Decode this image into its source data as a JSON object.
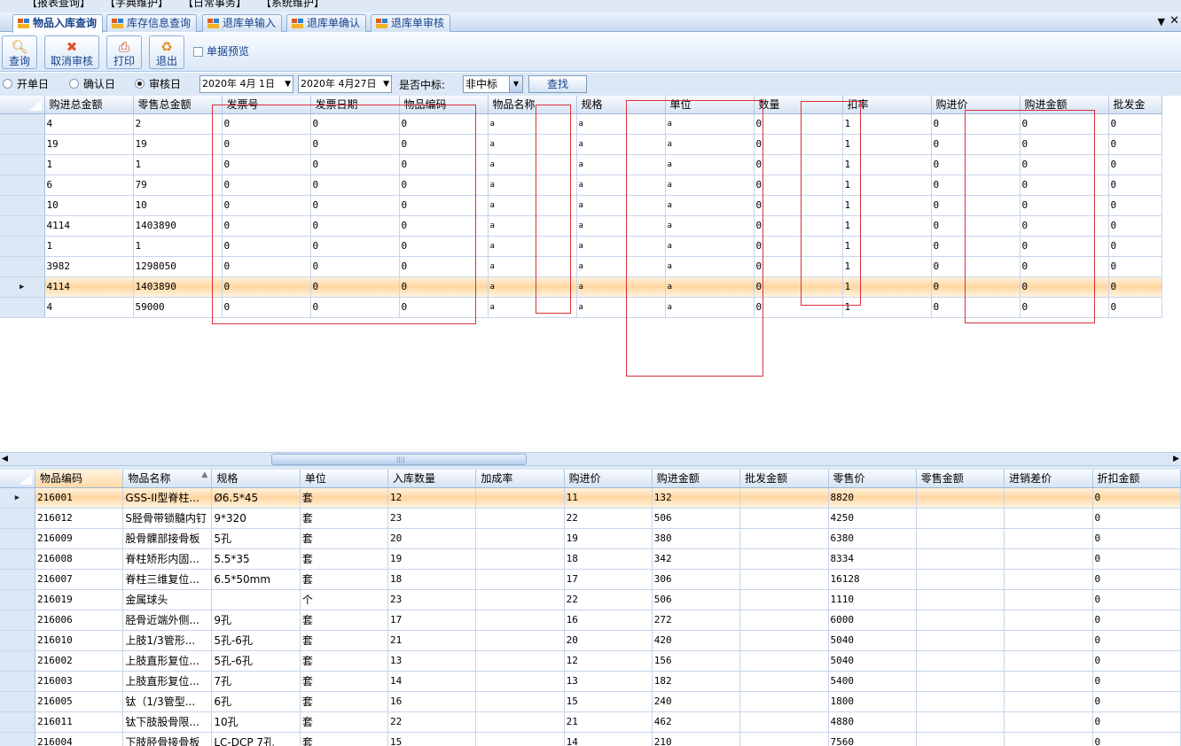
{
  "menu": [
    "】",
    "【报表查询】",
    "【字典维护】",
    "【日常事务】",
    "【系统维护】"
  ],
  "tabs": [
    "物品入库查询",
    "库存信息查询",
    "退库单输入",
    "退库单确认",
    "退库单审核"
  ],
  "tab_controls": {
    "menu": "▼",
    "close": "✕"
  },
  "toolbar": {
    "query": "查询",
    "cancel_audit": "取消审核",
    "print": "打印",
    "exit": "退出",
    "preview": "单据预览"
  },
  "filters": {
    "radio_open": "开单日",
    "radio_confirm": "确认日",
    "radio_audit": "审核日",
    "date_from": "2020年 4月 1日",
    "date_to": "2020年 4月27日",
    "bid_label": "是否中标:",
    "bid_value": "非中标",
    "find": "查找"
  },
  "grid1": {
    "columns": [
      "购进总金额",
      "零售总金额",
      "发票号",
      "发票日期",
      "物品编码",
      "物品名称",
      "规格",
      "单位",
      "数量",
      "扣率",
      "购进价",
      "购进金额",
      "批发金"
    ],
    "rows": [
      [
        "4",
        "2",
        "0",
        "0",
        "0",
        "a",
        "a",
        "a",
        "0",
        "1",
        "0",
        "0",
        "0"
      ],
      [
        "19",
        "19",
        "0",
        "0",
        "0",
        "a",
        "a",
        "a",
        "0",
        "1",
        "0",
        "0",
        "0"
      ],
      [
        "1",
        "1",
        "0",
        "0",
        "0",
        "a",
        "a",
        "a",
        "0",
        "1",
        "0",
        "0",
        "0"
      ],
      [
        "6",
        "79",
        "0",
        "0",
        "0",
        "a",
        "a",
        "a",
        "0",
        "1",
        "0",
        "0",
        "0"
      ],
      [
        "10",
        "10",
        "0",
        "0",
        "0",
        "a",
        "a",
        "a",
        "0",
        "1",
        "0",
        "0",
        "0"
      ],
      [
        "4114",
        "1403890",
        "0",
        "0",
        "0",
        "a",
        "a",
        "a",
        "0",
        "1",
        "0",
        "0",
        "0"
      ],
      [
        "1",
        "1",
        "0",
        "0",
        "0",
        "a",
        "a",
        "a",
        "0",
        "1",
        "0",
        "0",
        "0"
      ],
      [
        "3982",
        "1298050",
        "0",
        "0",
        "0",
        "a",
        "a",
        "a",
        "0",
        "1",
        "0",
        "0",
        "0"
      ],
      [
        "4114",
        "1403890",
        "0",
        "0",
        "0",
        "a",
        "a",
        "a",
        "0",
        "1",
        "0",
        "0",
        "0"
      ],
      [
        "4",
        "59000",
        "0",
        "0",
        "0",
        "a",
        "a",
        "a",
        "0",
        "1",
        "0",
        "0",
        "0"
      ]
    ],
    "selected_row": 8
  },
  "grid2": {
    "columns": [
      "物品编码",
      "物品名称",
      "规格",
      "单位",
      "入库数量",
      "加成率",
      "购进价",
      "购进金额",
      "批发金额",
      "零售价",
      "零售金额",
      "进销差价",
      "折扣金额"
    ],
    "sort_arrow": "▲",
    "rows": [
      [
        "216001",
        "GSS-II型脊柱...",
        "Ø6.5*45",
        "套",
        "12",
        "",
        "11",
        "132",
        "",
        "8820",
        "",
        "",
        "0"
      ],
      [
        "216012",
        "S胫骨带锁髓内钉",
        "9*320",
        "套",
        "23",
        "",
        "22",
        "506",
        "",
        "4250",
        "",
        "",
        "0"
      ],
      [
        "216009",
        "股骨髁部接骨板",
        "5孔",
        "套",
        "20",
        "",
        "19",
        "380",
        "",
        "6380",
        "",
        "",
        "0"
      ],
      [
        "216008",
        "脊柱矫形内固...",
        "5.5*35",
        "套",
        "19",
        "",
        "18",
        "342",
        "",
        "8334",
        "",
        "",
        "0"
      ],
      [
        "216007",
        "脊柱三维复位...",
        "6.5*50mm",
        "套",
        "18",
        "",
        "17",
        "306",
        "",
        "16128",
        "",
        "",
        "0"
      ],
      [
        "216019",
        "金属球头",
        "",
        "个",
        "23",
        "",
        "22",
        "506",
        "",
        "1110",
        "",
        "",
        "0"
      ],
      [
        "216006",
        "胫骨近端外侧...",
        "9孔",
        "套",
        "17",
        "",
        "16",
        "272",
        "",
        "6000",
        "",
        "",
        "0"
      ],
      [
        "216010",
        "上肢1/3管形...",
        "5孔-6孔",
        "套",
        "21",
        "",
        "20",
        "420",
        "",
        "5040",
        "",
        "",
        "0"
      ],
      [
        "216002",
        "上肢直形复位...",
        "5孔-6孔",
        "套",
        "13",
        "",
        "12",
        "156",
        "",
        "5040",
        "",
        "",
        "0"
      ],
      [
        "216003",
        "上肢直形复位...",
        "7孔",
        "套",
        "14",
        "",
        "13",
        "182",
        "",
        "5400",
        "",
        "",
        "0"
      ],
      [
        "216005",
        "钛（1/3管型...",
        "6孔",
        "套",
        "16",
        "",
        "15",
        "240",
        "",
        "1800",
        "",
        "",
        "0"
      ],
      [
        "216011",
        "钛下肢股骨限...",
        "10孔",
        "套",
        "22",
        "",
        "21",
        "462",
        "",
        "4880",
        "",
        "",
        "0"
      ],
      [
        "216004",
        "下肢胫骨接骨板",
        "LC-DCP 7孔",
        "套",
        "15",
        "",
        "14",
        "210",
        "",
        "7560",
        "",
        "",
        "0"
      ]
    ],
    "selected_row": 0
  },
  "scrollbar": {
    "left": "◀",
    "right": "▶",
    "grip": "||||"
  },
  "row_marker": "▶",
  "colors": {
    "annotation": "#d9303a",
    "selection": "#ffd6a0",
    "header": "#d6e3f3",
    "tab_text": "#15428b"
  }
}
